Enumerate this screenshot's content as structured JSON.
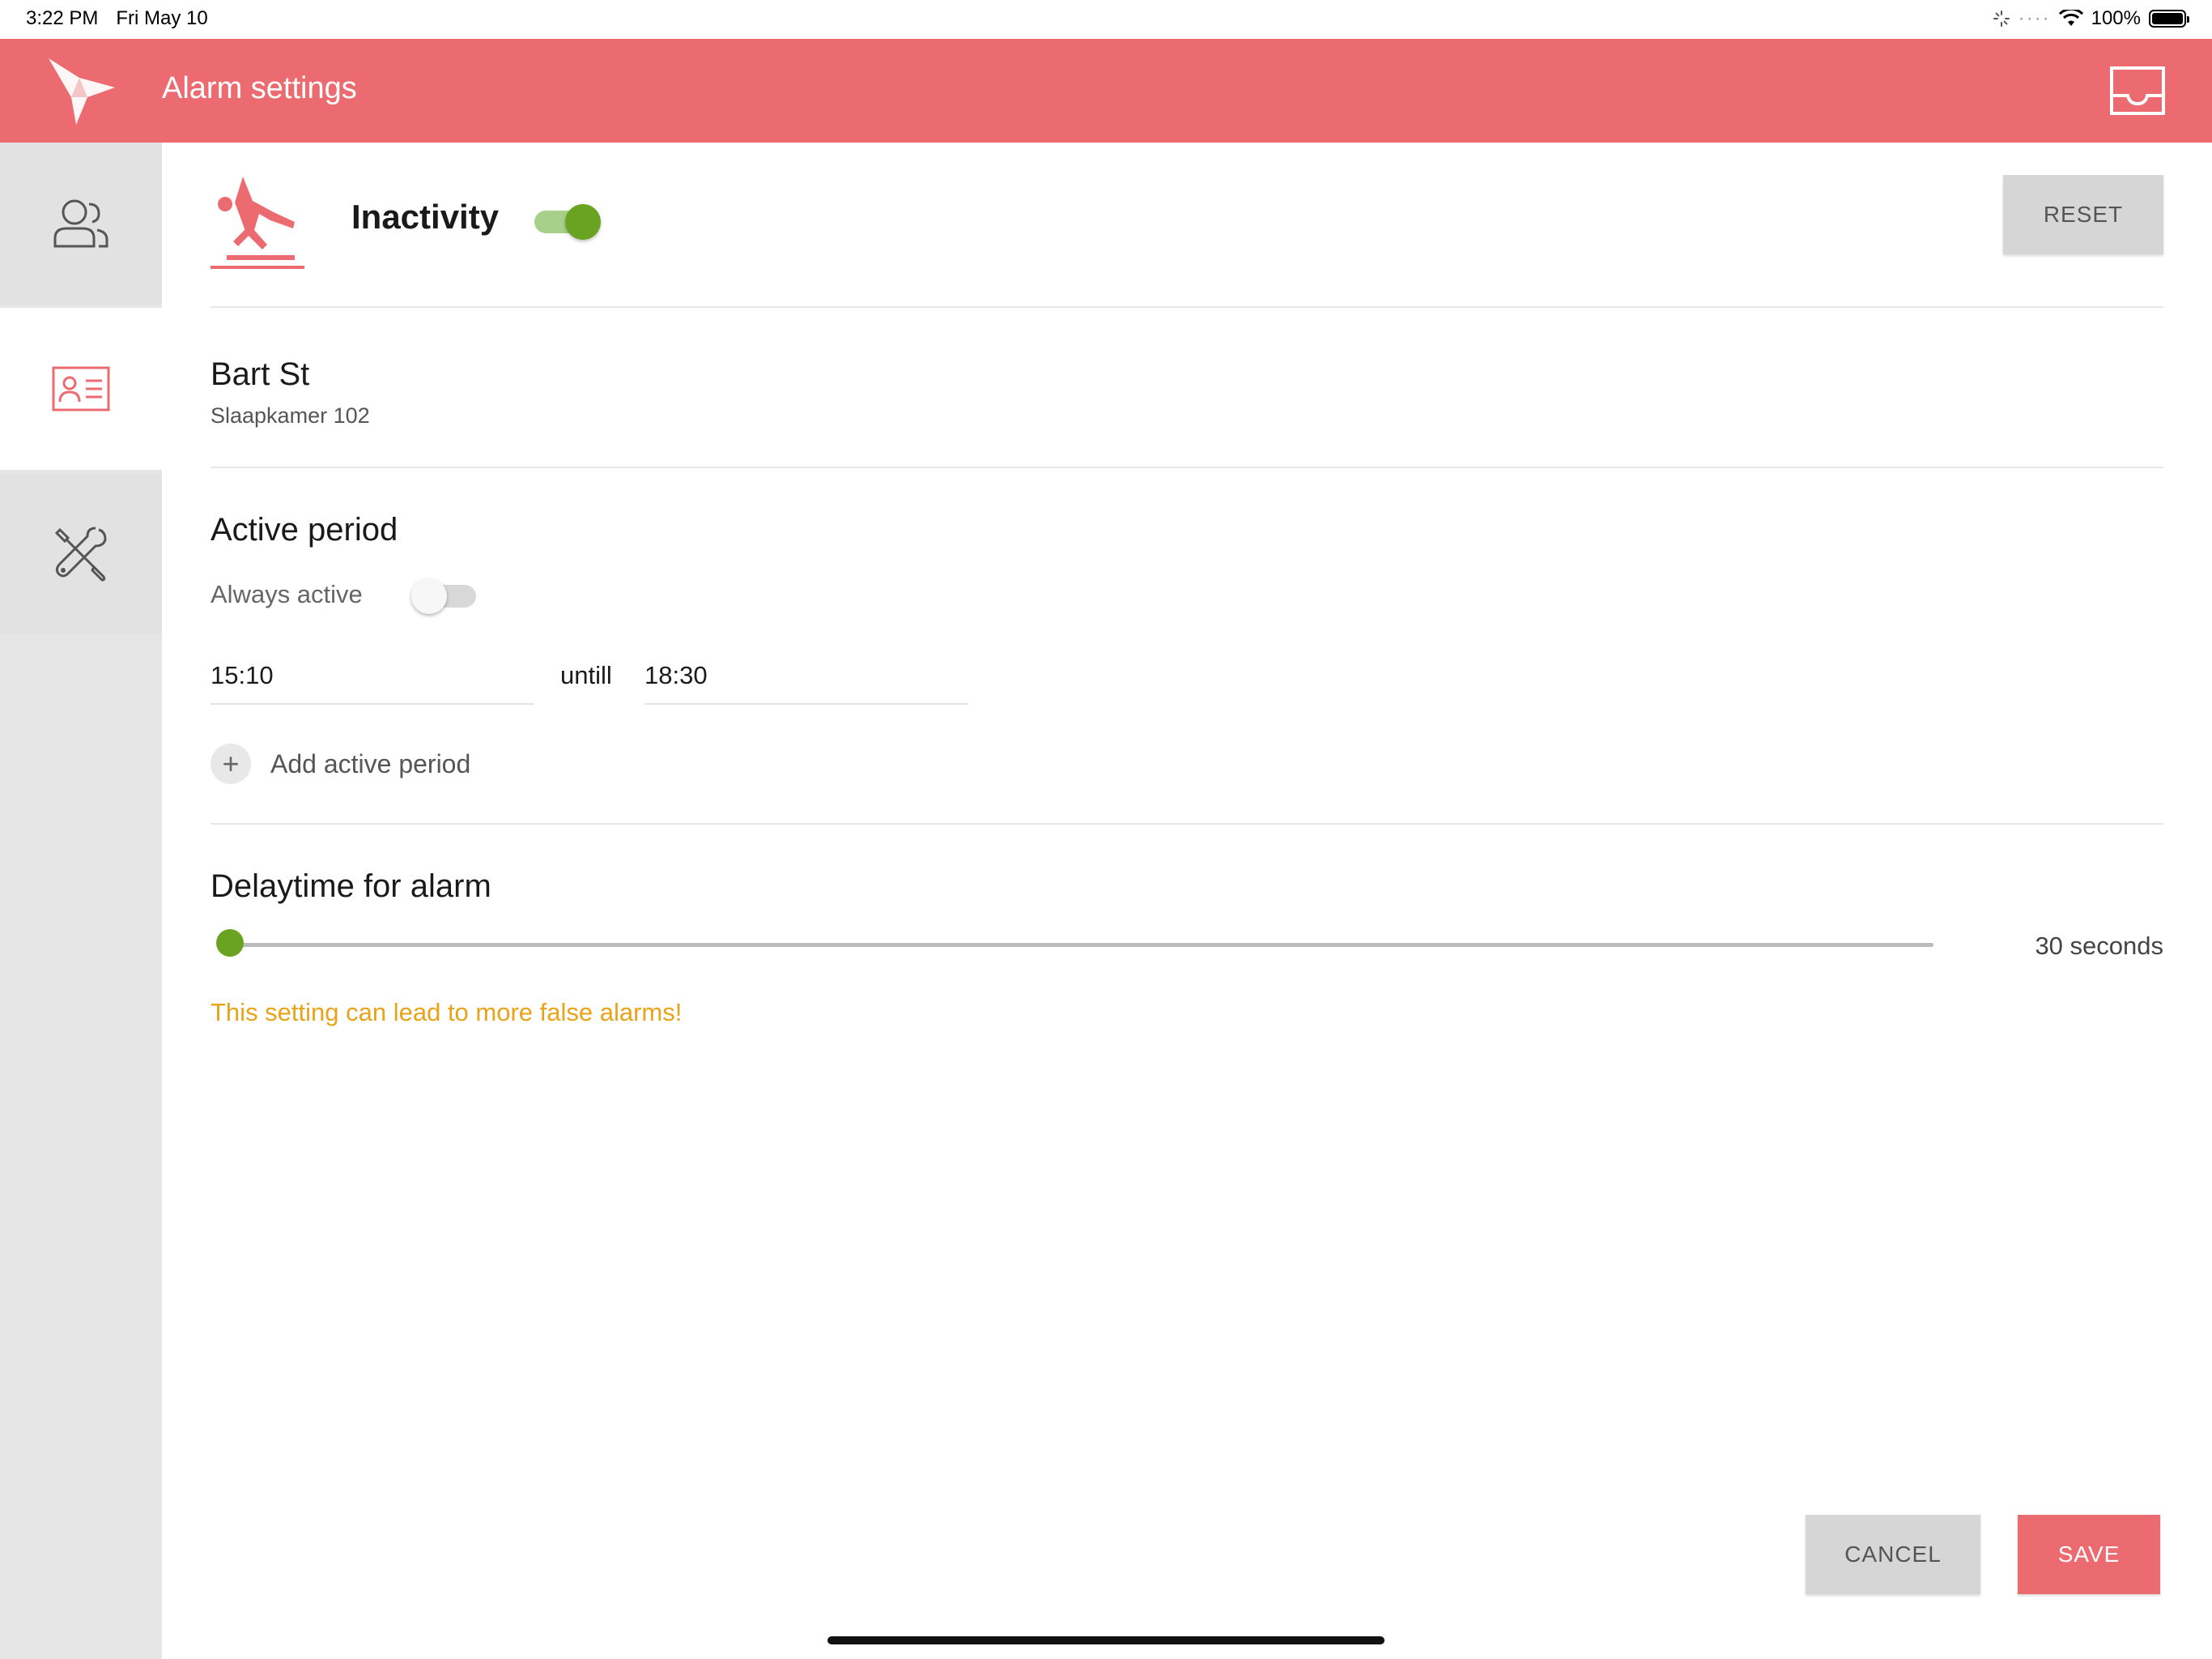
{
  "status_bar": {
    "time": "3:22 PM",
    "date": "Fri May 10",
    "battery": "100%"
  },
  "app_bar": {
    "title": "Alarm settings"
  },
  "sidebar": {
    "items": [
      {
        "icon": "users-icon",
        "active": false
      },
      {
        "icon": "profile-card-icon",
        "active": true
      },
      {
        "icon": "tools-icon",
        "active": false
      }
    ]
  },
  "alarm": {
    "name": "Inactivity",
    "enabled": true,
    "reset_label": "RESET"
  },
  "person": {
    "name": "Bart St",
    "room": "Slaapkamer 102"
  },
  "active_period": {
    "title": "Active period",
    "always_active_label": "Always active",
    "always_active": false,
    "from": "15:10",
    "until_label": "untill",
    "to": "18:30",
    "add_label": "Add active period"
  },
  "delay": {
    "title": "Delaytime for alarm",
    "slider_fraction": 0,
    "value_label": "30 seconds",
    "warning": "This setting can lead to more false alarms!"
  },
  "actions": {
    "cancel_label": "CANCEL",
    "save_label": "SAVE"
  },
  "colors": {
    "brand": "#ec6b70",
    "toggle_on": "#6aa321",
    "warning": "#e8a318"
  }
}
